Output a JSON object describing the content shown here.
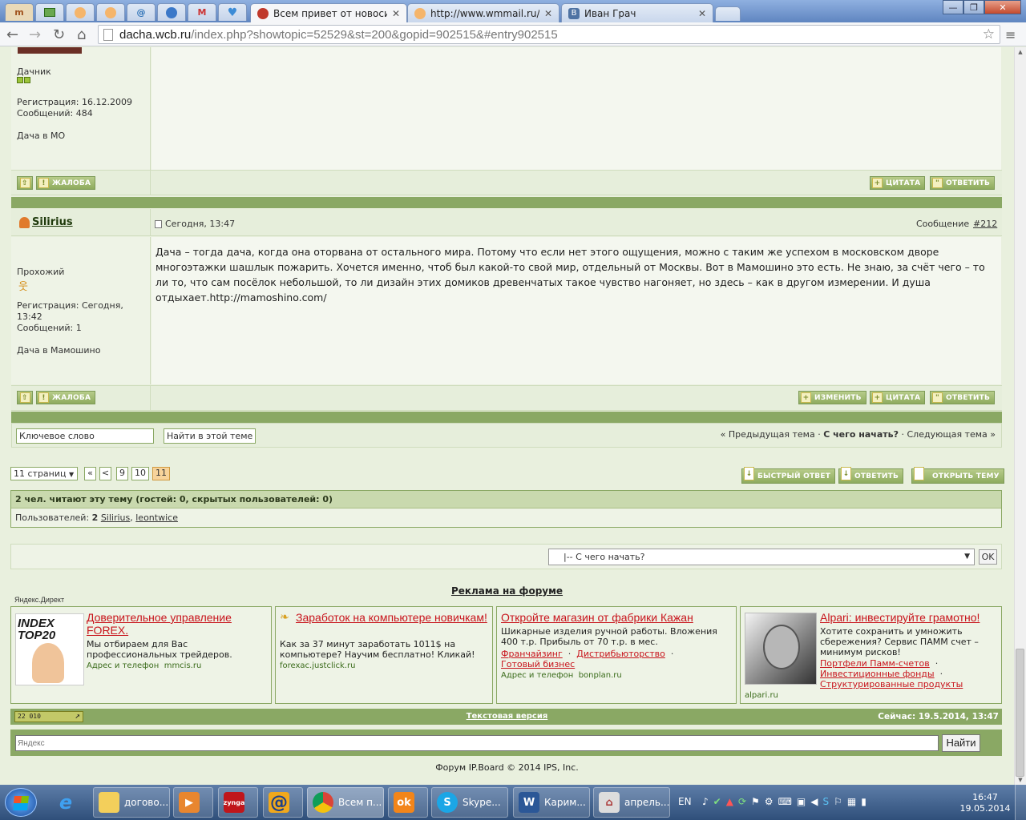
{
  "browser": {
    "tabs": [
      {
        "title": "Всем привет от новосиб",
        "active": true
      },
      {
        "title": "http://www.wmmail.ru/in",
        "active": false
      },
      {
        "title": "Иван Грач",
        "active": false
      }
    ],
    "pinned_glyphs": [
      "m",
      "",
      "",
      "@",
      "",
      "M",
      ""
    ],
    "url_host": "dacha.wcb.ru",
    "url_path": "/index.php?showtopic=52529&st=200&gopid=902515&#entry902515"
  },
  "prev_post": {
    "rank": "Дачник",
    "reg": "Регистрация: 16.12.2009",
    "posts": "Сообщений: 484",
    "location": "Дача в МО",
    "btn_top": "",
    "btn_report": "ЖАЛОБА",
    "btn_quote": "ЦИТАТА",
    "btn_reply": "ОТВЕТИТЬ"
  },
  "post": {
    "author": "Silirius",
    "date": "Сегодня, 13:47",
    "msg_label": "Сообщение",
    "msg_num": "#212",
    "rank": "Прохожий",
    "reg": "Регистрация: Сегодня, 13:42",
    "posts": "Сообщений: 1",
    "location": "Дача в Мамошино",
    "text": "Дача – тогда дача, когда она оторвана от остального мира. Потому что если нет этого ощущения, можно с таким же успехом в московском дворе многоэтажки шашлык пожарить. Хочется именно, чтоб был какой-то свой мир, отдельный от Москвы. Вот в Мамошино это есть. Не знаю, за счёт чего – то ли то, что сам посёлок небольшой, то ли дизайн этих домиков древенчатых такое чувство нагоняет, но здесь – как в другом измерении. И душа отдыхает.http://mamoshino.com/",
    "btn_report": "ЖАЛОБА",
    "btn_edit": "ИЗМЕНИТЬ",
    "btn_quote": "ЦИТАТА",
    "btn_reply": "ОТВЕТИТЬ"
  },
  "search": {
    "placeholder": "Ключевое слово",
    "button": "Найти в этой теме"
  },
  "topic_nav": {
    "prev": "« Предыдущая тема",
    "sep": "·",
    "current": "С чего начать?",
    "next": "Следующая тема »"
  },
  "pagination": {
    "pages_label": "11 страниц",
    "first": "«",
    "prev": "<",
    "pages": [
      "9",
      "10",
      "11"
    ],
    "current": "11"
  },
  "actions": {
    "fast_reply": "БЫСТРЫЙ ОТВЕТ",
    "reply": "ОТВЕТИТЬ",
    "new_topic": "ОТКРЫТЬ ТЕМУ"
  },
  "online": {
    "header": "2 чел. читают эту тему (гостей: 0, скрытых пользователей: 0)",
    "users_label": "Пользователей:",
    "users_count": "2",
    "users": [
      "Silirius",
      "leontwice"
    ]
  },
  "jump": {
    "selected": "|-- С чего начать?",
    "ok": "OK"
  },
  "ads": {
    "title": "Реклама на форуме",
    "yandex": "Яндекс.Директ",
    "items": [
      {
        "logo_text": "INDEX TOP20",
        "title": "Доверительное управление FOREX.",
        "text": "Мы отбираем для Вас профессиональных трейдеров.",
        "src_label": "Адрес и телефон",
        "src": "mmcis.ru"
      },
      {
        "title": "Заработок на компьютере новичкам!",
        "text": "Как за 37 минут заработать 1011$ на компьютере? Научим бесплатно! Кликай!",
        "src": "forexac.justclick.ru"
      },
      {
        "title": "Откройте магазин от фабрики Кажан",
        "text": "Шикарные изделия ручной работы. Вложения 400 т.р. Прибыль от 70 т.р. в мес.",
        "links": [
          "Франчайзинг",
          "Дистрибьюторство",
          "Готовый бизнес"
        ],
        "src_label": "Адрес и телефон",
        "src": "bonplan.ru"
      },
      {
        "title": "Alpari: инвестируйте грамотно!",
        "text": "Хотите сохранить и умножить сбережения? Сервис ПАММ счет – минимум рисков!",
        "links": [
          "Портфели Памм-счетов",
          "Инвестиционные фонды",
          "Структурированные продукты"
        ],
        "src": "alpari.ru"
      }
    ]
  },
  "footer": {
    "badge": "22 010",
    "text_version": "Текстовая версия",
    "now": "Сейчас: 19.5.2014, 13:47",
    "yandex_placeholder": "Яндекс",
    "find": "Найти",
    "copyright": "Форум IP.Board © 2014  IPS, Inc."
  },
  "taskbar": {
    "items": [
      "догово...",
      "",
      "",
      "",
      "",
      "Всем п...",
      "",
      "Skype...",
      "Карим...",
      "апрель..."
    ],
    "lang": "EN",
    "time": "16:47",
    "date": "19.05.2014"
  },
  "colors": {
    "forum_green": "#8aa864",
    "ad_red": "#c8141c",
    "bg": "#e9f0de"
  }
}
